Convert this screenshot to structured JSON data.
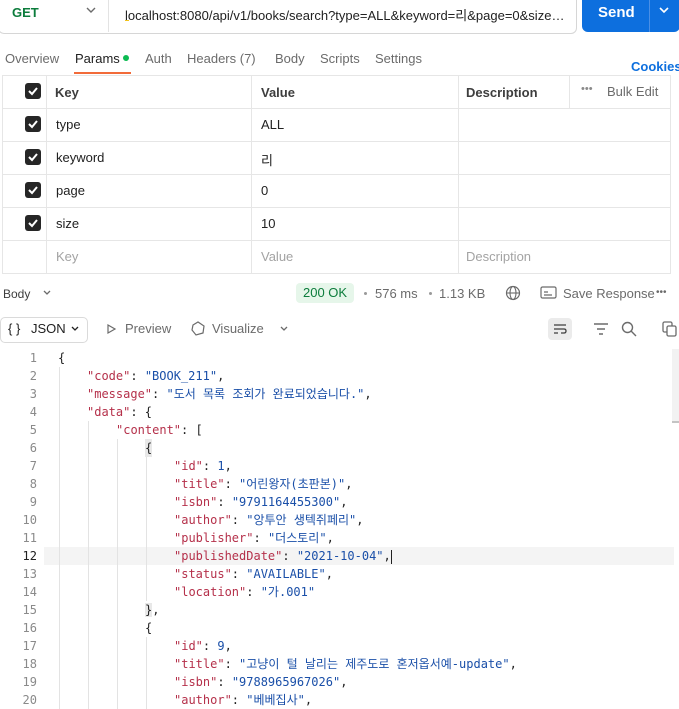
{
  "request": {
    "method": "GET",
    "url": "localhost:8080/api/v1/books/search?type=ALL&keyword=리&page=0&size= ...",
    "send_label": "Send"
  },
  "tabs": [
    {
      "label": "Overview"
    },
    {
      "label": "Params"
    },
    {
      "label": "Auth"
    },
    {
      "label": "Headers (7)"
    },
    {
      "label": "Body"
    },
    {
      "label": "Scripts"
    },
    {
      "label": "Settings"
    }
  ],
  "cookies_label": "Cookies",
  "params_table": {
    "headers": {
      "key": "Key",
      "value": "Value",
      "description": "Description",
      "bulk_edit": "Bulk Edit",
      "more": "•••"
    },
    "rows": [
      {
        "key": "type",
        "value": "ALL",
        "checked": true
      },
      {
        "key": "keyword",
        "value": "리",
        "checked": true
      },
      {
        "key": "page",
        "value": "0",
        "checked": true
      },
      {
        "key": "size",
        "value": "10",
        "checked": true
      }
    ],
    "placeholders": {
      "key": "Key",
      "value": "Value",
      "description": "Description"
    }
  },
  "response": {
    "section_label": "Body",
    "status": "200 OK",
    "time": "576 ms",
    "size": "1.13 KB",
    "save_label": "Save Response",
    "more": "•••",
    "format_label": "JSON",
    "preview_label": "Preview",
    "visualize_label": "Visualize"
  },
  "code_lines": [
    "1",
    "2",
    "3",
    "4",
    "5",
    "6",
    "7",
    "8",
    "9",
    "10",
    "11",
    "12",
    "13",
    "14",
    "15",
    "16",
    "17",
    "18",
    "19",
    "20"
  ],
  "json": {
    "code_key": "\"code\"",
    "code_val": "\"BOOK_211\"",
    "message_key": "\"message\"",
    "message_val": "\"도서 목록 조회가 완료되었습니다.\"",
    "data_key": "\"data\"",
    "content_key": "\"content\"",
    "item1": {
      "id_key": "\"id\"",
      "id_val": "1",
      "title_key": "\"title\"",
      "title_val": "\"어린왕자(초판본)\"",
      "isbn_key": "\"isbn\"",
      "isbn_val": "\"9791164455300\"",
      "author_key": "\"author\"",
      "author_val": "\"앙투안 생텍쥐페리\"",
      "publisher_key": "\"publisher\"",
      "publisher_val": "\"더스토리\"",
      "date_key": "\"publishedDate\"",
      "date_val": "\"2021-10-04\"",
      "status_key": "\"status\"",
      "status_val": "\"AVAILABLE\"",
      "location_key": "\"location\"",
      "location_val": "\"가.001\""
    },
    "item2": {
      "id_key": "\"id\"",
      "id_val": "9",
      "title_key": "\"title\"",
      "title_val": "\"고냥이 털 날리는 제주도로 혼저옵서예-update\"",
      "isbn_key": "\"isbn\"",
      "isbn_val": "\"9788965967026\"",
      "author_key": "\"author\"",
      "author_val": "\"베베집사\""
    }
  },
  "colors": {
    "accent": "#0d6fde",
    "status_ok": "#0c7c3c",
    "tab_underline": "#f26b3a"
  }
}
